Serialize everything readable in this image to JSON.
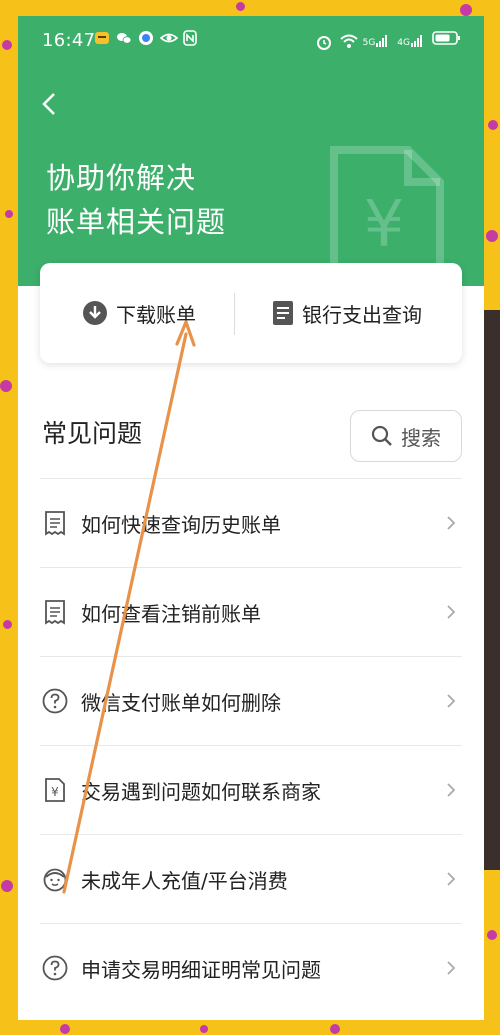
{
  "status_bar": {
    "time": "16:47",
    "left_icons": [
      "app-notification-icon",
      "wechat-icon",
      "message-icon",
      "eye-icon",
      "nfc-icon"
    ],
    "right_icons": [
      "alarm-icon",
      "wifi-icon",
      "signal-5g-icon",
      "signal-4g-icon",
      "battery-icon"
    ],
    "net1": "5G",
    "net2": "4G"
  },
  "header": {
    "back_icon": "chevron-left-icon",
    "title_line1": "协助你解决",
    "title_line2": "账单相关问题",
    "watermark_icon": "yuan-document-icon",
    "watermark_symbol": "¥",
    "color": "#3caf6b"
  },
  "actions": {
    "download_label": "下载账单",
    "download_icon": "download-circle-icon",
    "bank_label": "银行支出查询",
    "bank_icon": "document-icon"
  },
  "faq": {
    "title": "常见问题",
    "search_label": "搜索",
    "items": [
      {
        "label": "如何快速查询历史账单",
        "icon": "receipt-icon"
      },
      {
        "label": "如何查看注销前账单",
        "icon": "receipt-icon"
      },
      {
        "label": "微信支付账单如何删除",
        "icon": "question-circle-icon"
      },
      {
        "label": "交易遇到问题如何联系商家",
        "icon": "yuan-receipt-icon"
      },
      {
        "label": "未成年人充值/平台消费",
        "icon": "child-face-icon"
      },
      {
        "label": "申请交易明细证明常见问题",
        "icon": "question-circle-icon"
      }
    ]
  },
  "annotation": {
    "description_icon": "orange-arrow-icon",
    "color": "#e8924a"
  }
}
